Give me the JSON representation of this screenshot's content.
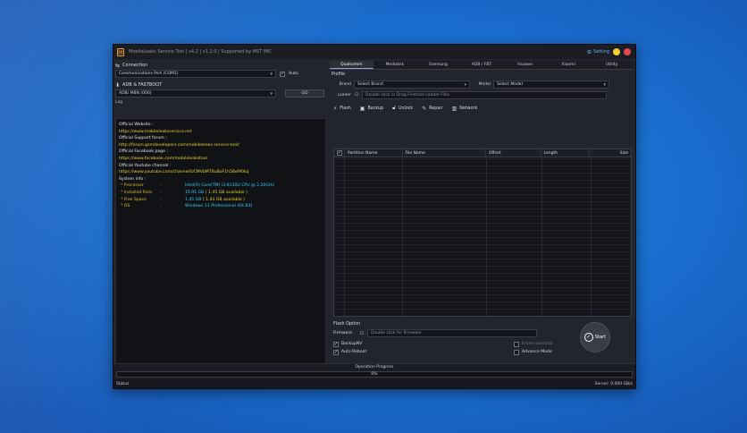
{
  "window": {
    "title": "MobileLeaks Service Tool | v4.2 | v1.2.0 | Supported by MST IMC",
    "setting_label": "Setting",
    "colors": {
      "accent": "#2c8be8",
      "log_link": "#e8d32c",
      "log_value": "#2fd1ff",
      "log_key": "#e8b92c"
    }
  },
  "connection": {
    "label": "Connection",
    "port_value": "Communications Port (COM1)",
    "auto_label": "Auto",
    "auto_checked": true
  },
  "adb": {
    "label": "ADB & FASTBOOT",
    "device_value": "ADB/ MBN (000)",
    "go_label": "GO"
  },
  "log": {
    "label": "Log",
    "lines": [
      {
        "text": "Official Website :",
        "style": "white"
      },
      {
        "text": "https://www.mobileleaksservice.net",
        "style": "link"
      },
      {
        "text": "Official Support forum :",
        "style": "white"
      },
      {
        "text": "http://forum.gsmdevelopers.com/mobileleaks-service-tool/",
        "style": "link"
      },
      {
        "text": "Official Facebook page :",
        "style": "white"
      },
      {
        "text": "https://www.facebook.com/mobileleakstool",
        "style": "link"
      },
      {
        "text": "Official Youtube channel :",
        "style": "white"
      },
      {
        "text": "https://www.youtube.com/channel/UCMVbMTBuBoF1h5BeM0kq",
        "style": "link"
      },
      {
        "text": "System info :",
        "style": "white"
      }
    ],
    "system_info": [
      {
        "key": "* Processor",
        "sep": ":",
        "value": "Intel(R) Core(TM) i3-8130U CPU @ 2.20GHz",
        "extra": ""
      },
      {
        "key": "* Installed Ram",
        "sep": ":",
        "value": "15.91 GB",
        "extra": "( 1.45 GB available )"
      },
      {
        "key": "* Free Space",
        "sep": ":",
        "value": "1.45 GB",
        "extra": "( 1.43 GB available )"
      },
      {
        "key": "* OS",
        "sep": ":",
        "value": "Windows 11 Professional (64 Bit)",
        "extra": ""
      }
    ]
  },
  "tabs": [
    {
      "label": "Qualcomm",
      "active": true
    },
    {
      "label": "Mediatek",
      "active": false
    },
    {
      "label": "Samsung",
      "active": false
    },
    {
      "label": "ADB / FBT",
      "active": false
    },
    {
      "label": "Huawei",
      "active": false
    },
    {
      "label": "Xiaomi",
      "active": false
    },
    {
      "label": "Utility",
      "active": false
    }
  ],
  "profile": {
    "label": "Profile",
    "brand_label": "Brand",
    "brand_value": "Select Brand",
    "model_label": "Model",
    "model_value": "Select Model",
    "loader_label": "Loader",
    "loader_value": "Double click or Drag Firehose Loader Files"
  },
  "toolbar": {
    "flash": "Flash",
    "backup": "Backup",
    "unlock": "Unlock",
    "repair": "Repair",
    "network": "Network"
  },
  "table": {
    "columns": [
      "Partition Name",
      "File Name",
      "Offset",
      "Length",
      "Size"
    ]
  },
  "flash_option": {
    "label": "Flash Option",
    "firmware_label": "Firmware",
    "firmware_value": "Double click for firmware",
    "backup_label": "BackupNV",
    "backup_checked": true,
    "autoreboot_label": "Auto Reboot",
    "autoreboot_checked": true,
    "erase_label": "Erase userdata",
    "erase_checked": false,
    "advance_label": "Advance Mode",
    "advance_checked": false,
    "start_label": "Start"
  },
  "progress": {
    "label": "Operation Progress",
    "percent_text": "0%",
    "fraction": 0
  },
  "status": {
    "left": "Status",
    "right": "Server: 0.000 GB/s"
  }
}
